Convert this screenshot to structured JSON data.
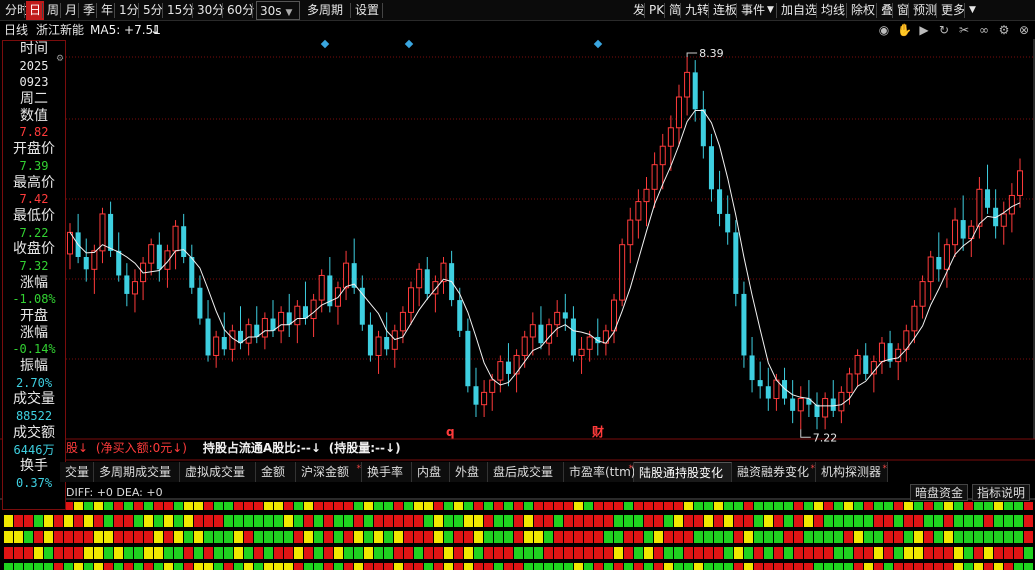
{
  "toolbar": {
    "left": [
      {
        "label": "分时",
        "active": false
      },
      {
        "label": "日",
        "active": true
      },
      {
        "label": "周",
        "active": false
      },
      {
        "label": "月",
        "active": false
      },
      {
        "label": "季",
        "active": false
      },
      {
        "label": "年",
        "active": false
      },
      {
        "label": "1分",
        "active": false
      },
      {
        "label": "5分",
        "active": false
      },
      {
        "label": "15分",
        "active": false
      },
      {
        "label": "30分",
        "active": false
      },
      {
        "label": "60分",
        "active": false
      }
    ],
    "period_dropdown": "30s",
    "multi_period": "多周期",
    "settings": "设置",
    "right": [
      "发",
      "PK",
      "简",
      "九转",
      "连板",
      "事件",
      "加自选",
      "均线",
      "除权",
      "叠",
      "窗",
      "预测",
      "更多"
    ]
  },
  "info": {
    "period": "日线",
    "stock_name": "浙江新能",
    "ma_label": "MA5: +7.51",
    "ma_arrow": "↓"
  },
  "datawindow": {
    "rows": [
      {
        "label": "时间",
        "value": "2025",
        "color": "#e8e8e8"
      },
      {
        "label": "",
        "value": "0923",
        "color": "#e8e8e8"
      },
      {
        "label": "周二",
        "value": "",
        "color": "#e8e8e8"
      },
      {
        "label": "数值",
        "value": "7.82",
        "color": "#ff3b3b"
      },
      {
        "label": "开盘价",
        "value": "7.39",
        "color": "#32d232"
      },
      {
        "label": "最高价",
        "value": "7.42",
        "color": "#ff3b3b"
      },
      {
        "label": "最低价",
        "value": "7.22",
        "color": "#32d232"
      },
      {
        "label": "收盘价",
        "value": "7.32",
        "color": "#32d232"
      },
      {
        "label": "涨幅",
        "value": "-1.08%",
        "color": "#32d232"
      },
      {
        "label": "开盘",
        "value": "",
        "color": "#e8e8e8"
      },
      {
        "label": "涨幅",
        "value": "-0.14%",
        "color": "#32d232"
      },
      {
        "label": "振幅",
        "value": "2.70%",
        "color": "#3ecfe0"
      },
      {
        "label": "成交量",
        "value": "88522",
        "color": "#3ecfe0"
      },
      {
        "label": "成交额",
        "value": "6446万",
        "color": "#3ecfe0"
      },
      {
        "label": "换手",
        "value": "0.37%",
        "color": "#3ecfe0"
      }
    ]
  },
  "chart_data": {
    "type": "candlestick",
    "price_high_label": "8.39",
    "price_low_label": "7.22",
    "event_markers": [
      "q",
      "财"
    ],
    "ylim": [
      7.0,
      8.5
    ],
    "candles": [
      [
        7.75,
        7.85,
        7.7,
        7.82
      ],
      [
        7.82,
        7.88,
        7.72,
        7.74
      ],
      [
        7.74,
        7.8,
        7.66,
        7.7
      ],
      [
        7.7,
        7.78,
        7.62,
        7.76
      ],
      [
        7.76,
        7.9,
        7.72,
        7.88
      ],
      [
        7.88,
        7.92,
        7.74,
        7.76
      ],
      [
        7.76,
        7.82,
        7.66,
        7.68
      ],
      [
        7.68,
        7.72,
        7.58,
        7.62
      ],
      [
        7.62,
        7.7,
        7.56,
        7.66
      ],
      [
        7.66,
        7.74,
        7.6,
        7.72
      ],
      [
        7.72,
        7.8,
        7.68,
        7.78
      ],
      [
        7.78,
        7.82,
        7.66,
        7.7
      ],
      [
        7.7,
        7.78,
        7.64,
        7.76
      ],
      [
        7.76,
        7.86,
        7.7,
        7.84
      ],
      [
        7.84,
        7.88,
        7.72,
        7.74
      ],
      [
        7.74,
        7.78,
        7.62,
        7.64
      ],
      [
        7.64,
        7.68,
        7.52,
        7.54
      ],
      [
        7.54,
        7.6,
        7.4,
        7.42
      ],
      [
        7.42,
        7.5,
        7.38,
        7.48
      ],
      [
        7.48,
        7.56,
        7.42,
        7.44
      ],
      [
        7.44,
        7.52,
        7.4,
        7.5
      ],
      [
        7.5,
        7.58,
        7.44,
        7.46
      ],
      [
        7.46,
        7.54,
        7.42,
        7.52
      ],
      [
        7.52,
        7.58,
        7.46,
        7.48
      ],
      [
        7.48,
        7.56,
        7.44,
        7.54
      ],
      [
        7.54,
        7.6,
        7.48,
        7.5
      ],
      [
        7.5,
        7.58,
        7.46,
        7.56
      ],
      [
        7.56,
        7.62,
        7.48,
        7.52
      ],
      [
        7.52,
        7.6,
        7.46,
        7.58
      ],
      [
        7.58,
        7.66,
        7.52,
        7.54
      ],
      [
        7.54,
        7.62,
        7.48,
        7.6
      ],
      [
        7.6,
        7.7,
        7.56,
        7.68
      ],
      [
        7.68,
        7.74,
        7.56,
        7.58
      ],
      [
        7.58,
        7.66,
        7.52,
        7.64
      ],
      [
        7.64,
        7.76,
        7.6,
        7.72
      ],
      [
        7.72,
        7.8,
        7.62,
        7.64
      ],
      [
        7.64,
        7.68,
        7.5,
        7.52
      ],
      [
        7.52,
        7.56,
        7.4,
        7.42
      ],
      [
        7.42,
        7.5,
        7.36,
        7.48
      ],
      [
        7.48,
        7.56,
        7.42,
        7.44
      ],
      [
        7.44,
        7.52,
        7.38,
        7.5
      ],
      [
        7.5,
        7.58,
        7.46,
        7.56
      ],
      [
        7.56,
        7.66,
        7.52,
        7.64
      ],
      [
        7.64,
        7.72,
        7.58,
        7.7
      ],
      [
        7.7,
        7.74,
        7.6,
        7.62
      ],
      [
        7.62,
        7.68,
        7.56,
        7.66
      ],
      [
        7.66,
        7.74,
        7.62,
        7.72
      ],
      [
        7.72,
        7.76,
        7.58,
        7.6
      ],
      [
        7.6,
        7.64,
        7.48,
        7.5
      ],
      [
        7.5,
        7.54,
        7.3,
        7.32
      ],
      [
        7.32,
        7.38,
        7.22,
        7.26
      ],
      [
        7.26,
        7.34,
        7.22,
        7.3
      ],
      [
        7.3,
        7.36,
        7.24,
        7.34
      ],
      [
        7.34,
        7.42,
        7.3,
        7.4
      ],
      [
        7.4,
        7.46,
        7.32,
        7.36
      ],
      [
        7.36,
        7.44,
        7.3,
        7.42
      ],
      [
        7.42,
        7.5,
        7.38,
        7.48
      ],
      [
        7.48,
        7.56,
        7.42,
        7.52
      ],
      [
        7.52,
        7.58,
        7.44,
        7.46
      ],
      [
        7.46,
        7.54,
        7.42,
        7.52
      ],
      [
        7.52,
        7.6,
        7.48,
        7.56
      ],
      [
        7.56,
        7.62,
        7.5,
        7.54
      ],
      [
        7.54,
        7.58,
        7.4,
        7.42
      ],
      [
        7.42,
        7.48,
        7.36,
        7.44
      ],
      [
        7.44,
        7.5,
        7.4,
        7.48
      ],
      [
        7.48,
        7.54,
        7.42,
        7.46
      ],
      [
        7.46,
        7.52,
        7.42,
        7.5
      ],
      [
        7.5,
        7.62,
        7.46,
        7.6
      ],
      [
        7.6,
        7.8,
        7.58,
        7.78
      ],
      [
        7.78,
        7.9,
        7.72,
        7.86
      ],
      [
        7.86,
        7.96,
        7.8,
        7.92
      ],
      [
        7.92,
        8.0,
        7.84,
        7.96
      ],
      [
        7.96,
        8.08,
        7.9,
        8.04
      ],
      [
        8.04,
        8.14,
        7.96,
        8.1
      ],
      [
        8.1,
        8.2,
        8.02,
        8.16
      ],
      [
        8.16,
        8.3,
        8.1,
        8.26
      ],
      [
        8.26,
        8.39,
        8.2,
        8.34
      ],
      [
        8.34,
        8.38,
        8.18,
        8.22
      ],
      [
        8.22,
        8.28,
        8.06,
        8.1
      ],
      [
        8.1,
        8.14,
        7.92,
        7.96
      ],
      [
        7.96,
        8.02,
        7.84,
        7.88
      ],
      [
        7.88,
        7.94,
        7.78,
        7.82
      ],
      [
        7.82,
        7.86,
        7.58,
        7.62
      ],
      [
        7.62,
        7.66,
        7.38,
        7.42
      ],
      [
        7.42,
        7.48,
        7.3,
        7.34
      ],
      [
        7.34,
        7.4,
        7.28,
        7.32
      ],
      [
        7.32,
        7.38,
        7.24,
        7.28
      ],
      [
        7.28,
        7.36,
        7.24,
        7.34
      ],
      [
        7.34,
        7.38,
        7.26,
        7.28
      ],
      [
        7.28,
        7.34,
        7.2,
        7.24
      ],
      [
        7.24,
        7.32,
        7.18,
        7.28
      ],
      [
        7.28,
        7.34,
        7.22,
        7.26
      ],
      [
        7.26,
        7.3,
        7.18,
        7.22
      ],
      [
        7.22,
        7.3,
        7.18,
        7.28
      ],
      [
        7.28,
        7.34,
        7.22,
        7.24
      ],
      [
        7.24,
        7.32,
        7.2,
        7.3
      ],
      [
        7.3,
        7.38,
        7.26,
        7.36
      ],
      [
        7.36,
        7.44,
        7.32,
        7.42
      ],
      [
        7.42,
        7.46,
        7.34,
        7.36
      ],
      [
        7.36,
        7.42,
        7.3,
        7.4
      ],
      [
        7.4,
        7.48,
        7.36,
        7.46
      ],
      [
        7.46,
        7.5,
        7.38,
        7.4
      ],
      [
        7.4,
        7.46,
        7.34,
        7.44
      ],
      [
        7.44,
        7.52,
        7.4,
        7.5
      ],
      [
        7.5,
        7.6,
        7.46,
        7.58
      ],
      [
        7.58,
        7.68,
        7.54,
        7.66
      ],
      [
        7.66,
        7.76,
        7.6,
        7.74
      ],
      [
        7.74,
        7.82,
        7.66,
        7.7
      ],
      [
        7.7,
        7.8,
        7.64,
        7.78
      ],
      [
        7.78,
        7.9,
        7.74,
        7.86
      ],
      [
        7.86,
        7.94,
        7.76,
        7.8
      ],
      [
        7.8,
        7.86,
        7.74,
        7.84
      ],
      [
        7.84,
        8.0,
        7.8,
        7.96
      ],
      [
        7.96,
        8.04,
        7.88,
        7.9
      ],
      [
        7.9,
        7.96,
        7.8,
        7.84
      ],
      [
        7.84,
        7.92,
        7.78,
        7.88
      ],
      [
        7.88,
        7.98,
        7.82,
        7.94
      ],
      [
        7.94,
        8.06,
        7.9,
        8.02
      ]
    ]
  },
  "hk_connect": {
    "prefix": "股↓",
    "net_buy": "(净买入额:0元↓)",
    "hold_ratio": "持股占流通A股比:--↓",
    "hold_qty": "(持股量:--↓)"
  },
  "tabs": [
    {
      "label": "交量",
      "active": false,
      "star": false
    },
    {
      "label": "多周期成交量",
      "active": false,
      "star": false
    },
    {
      "label": "虚拟成交量",
      "active": false,
      "star": false
    },
    {
      "label": "金额",
      "active": false,
      "star": false
    },
    {
      "label": "沪深金额",
      "active": false,
      "star": true
    },
    {
      "label": "换手率",
      "active": false,
      "star": false
    },
    {
      "label": "内盘",
      "active": false,
      "star": false
    },
    {
      "label": "外盘",
      "active": false,
      "star": false
    },
    {
      "label": "盘后成交量",
      "active": false,
      "star": false
    },
    {
      "label": "市盈率(ttm)",
      "active": false,
      "star": true
    },
    {
      "label": "陆股通持股变化",
      "active": true,
      "star": false
    },
    {
      "label": "融资融券变化",
      "active": false,
      "star": true
    },
    {
      "label": "机构探测器",
      "active": false,
      "star": true
    }
  ],
  "macd": {
    "text": "DIFF: +0 DEA: +0",
    "btn_dark_money": "暗盘资金",
    "btn_indicator_help": "指标说明"
  },
  "colors": {
    "up": "#ff3b3b",
    "down": "#3ecfe0",
    "ma": "#f2f2f2",
    "grid": "#7a0d0d",
    "heat_red": "#e01414",
    "heat_green": "#1fd21f",
    "heat_yellow": "#f0e800"
  }
}
